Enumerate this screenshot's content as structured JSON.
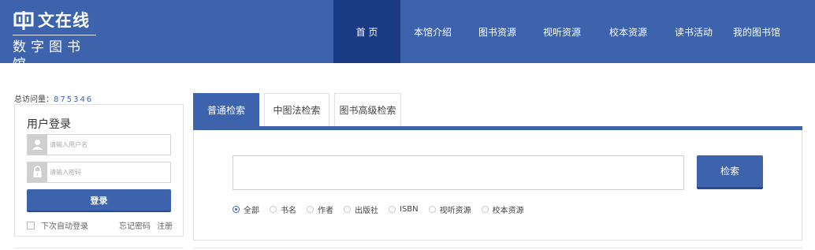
{
  "header": {
    "logo_title": "文在线",
    "logo_subtitle": "数字图书馆",
    "brand_color": "#3d63ad",
    "active_color": "#1a3a84",
    "nav": [
      {
        "label": "首 页",
        "active": true
      },
      {
        "label": "本馆介绍",
        "active": false
      },
      {
        "label": "图书资源",
        "active": false
      },
      {
        "label": "视听资源",
        "active": false
      },
      {
        "label": "校本资源",
        "active": false
      },
      {
        "label": "读书活动",
        "active": false
      },
      {
        "label": "我的图书馆",
        "active": false
      }
    ]
  },
  "sidebar": {
    "visit_label": "总访问量：",
    "visit_count": "875346",
    "login": {
      "title": "用户登录",
      "username_placeholder": "请输入用户名",
      "password_placeholder": "请输入密码",
      "username_icon": "user-icon",
      "password_icon": "lock-icon",
      "submit_label": "登录",
      "auto_login_label": "下次自动登录",
      "forgot_label": "忘记密码",
      "register_label": "注册"
    }
  },
  "search": {
    "tabs": [
      {
        "label": "普通检索",
        "active": true
      },
      {
        "label": "中图法检索",
        "active": false
      },
      {
        "label": "图书高级检索",
        "active": false
      }
    ],
    "query_value": "",
    "button_label": "检索",
    "options": [
      {
        "label": "全部",
        "selected": true
      },
      {
        "label": "书名",
        "selected": false
      },
      {
        "label": "作者",
        "selected": false
      },
      {
        "label": "出版社",
        "selected": false
      },
      {
        "label": "ISBN",
        "selected": false
      },
      {
        "label": "视听资源",
        "selected": false
      },
      {
        "label": "校本资源",
        "selected": false
      }
    ]
  }
}
